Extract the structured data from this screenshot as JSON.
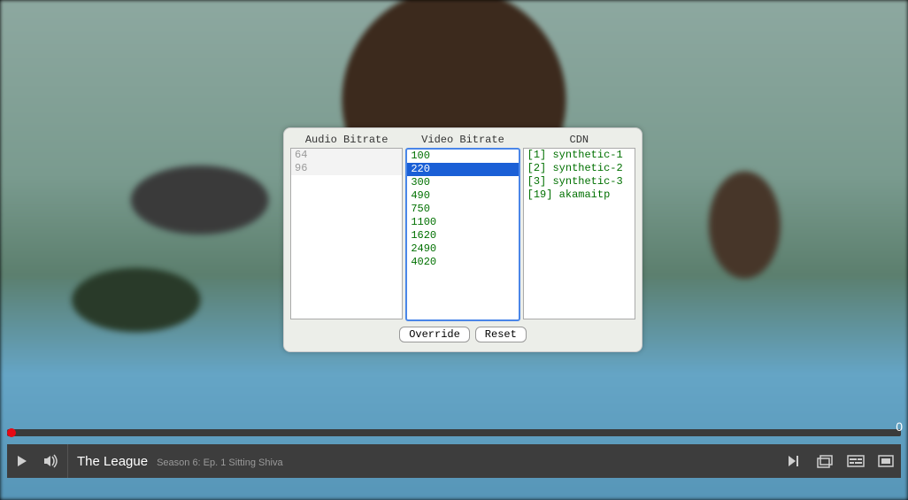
{
  "panel": {
    "columns": {
      "audio": {
        "title": "Audio Bitrate",
        "options": [
          {
            "label": "64",
            "disabled": true
          },
          {
            "label": "96",
            "disabled": true
          }
        ]
      },
      "video": {
        "title": "Video Bitrate",
        "selected_index": 1,
        "options": [
          {
            "label": "100"
          },
          {
            "label": "220"
          },
          {
            "label": "300"
          },
          {
            "label": "490"
          },
          {
            "label": "750"
          },
          {
            "label": "1100"
          },
          {
            "label": "1620"
          },
          {
            "label": "2490"
          },
          {
            "label": "4020"
          }
        ]
      },
      "cdn": {
        "title": "CDN",
        "options": [
          {
            "label": "[1] synthetic-1"
          },
          {
            "label": "[2] synthetic-2"
          },
          {
            "label": "[3] synthetic-3"
          },
          {
            "label": "[19] akamaitp"
          }
        ]
      }
    },
    "buttons": {
      "override": "Override",
      "reset": "Reset"
    }
  },
  "scrub": {
    "time_remaining": "0"
  },
  "player": {
    "title": "The League",
    "subtitle": "Season 6: Ep. 1  Sitting Shiva"
  }
}
